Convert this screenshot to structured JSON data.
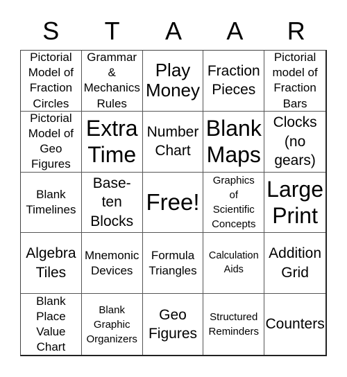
{
  "header": {
    "letters": [
      "S",
      "T",
      "A",
      "A",
      "R"
    ]
  },
  "board": {
    "cells": [
      "Pictorial\nModel of\nFraction\nCircles",
      "Grammar\n&\nMechanics\nRules",
      "Play\nMoney",
      "Fraction\nPieces",
      "Pictorial\nmodel of\nFraction\nBars",
      "Pictorial\nModel of\nGeo\nFigures",
      "Extra\nTime",
      "Number\nChart",
      "Blank\nMaps",
      "Clocks\n(no\ngears)",
      "Blank\nTimelines",
      "Base-\nten\nBlocks",
      "Free!",
      "Graphics\nof\nScientific\nConcepts",
      "Large\nPrint",
      "Algebra\nTiles",
      "Mnemonic\nDevices",
      "Formula\nTriangles",
      "Calculation\nAids",
      "Addition\nGrid",
      "Blank\nPlace\nValue\nChart",
      "Blank\nGraphic\nOrganizers",
      "Geo\nFigures",
      "Structured\nReminders",
      "Counters"
    ]
  }
}
